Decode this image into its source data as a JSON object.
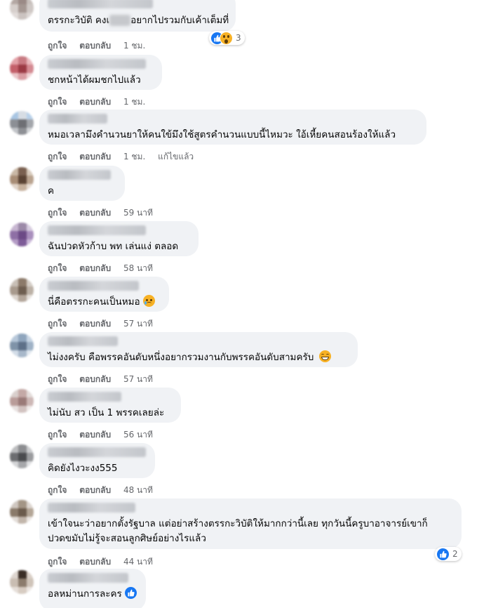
{
  "colors": {
    "bubble": "#f0f2f5",
    "action_text": "#65676b",
    "like_blue": "#1877f2",
    "emoji_yellow": "#f7b125"
  },
  "action_labels": {
    "like": "ถูกใจ",
    "reply": "ตอบกลับ"
  },
  "comments": [
    {
      "text_before": "ตรรกะวิบัติ คงเ",
      "text_after": "อยากไปรวมกับเค้าเต็มที่",
      "time": "1 ชม.",
      "reactions": {
        "icons": [
          "like-icon",
          "wow-icon"
        ],
        "count": "3"
      }
    },
    {
      "text": "ชกหน้าได้ผมชกไปแล้ว",
      "time": "1 ชม."
    },
    {
      "text": "หมอเวลามึงคำนวนยาให้คนใข้มึงใช้สูตรคำนวนแบบนี้ไหมวะ ใอ้เหี้ยคนสอนร้องให้แล้ว",
      "time": "1 ชม.",
      "edited": "แก้ไขแล้ว"
    },
    {
      "text": "ค",
      "time": "59 นาที"
    },
    {
      "text": "ฉันปวดหัวก้าบ พท เล่นแง่ ตลอด",
      "time": "58 นาที"
    },
    {
      "text": "นี่คือตรรกะคนเป็นหมอ",
      "emoji": "sad-tear-emoji",
      "time": "57 นาที"
    },
    {
      "text": "ไม่งงครับ คือพรรคอันดับหนึ่งอยากรวมงานกับพรรคอันดับสามครับ",
      "emoji": "grin-sweat-emoji",
      "time": "57 นาที"
    },
    {
      "text": "ไม่นับ สว เป็น 1 พรรคเลยล่ะ",
      "time": "56 นาที"
    },
    {
      "text": "คิดยังไงวะงง555",
      "time": "48 นาที"
    },
    {
      "line1": "เข้าใจนะว่าอยากตั้งรัฐบาล แต่อย่าสร้างตรรกะวิบัติให้มากกว่านี้เลย ทุกวันนี้ครูบาอาจารย์เขาก็",
      "line2": "ปวดขมับไม่รู้จะสอนลูกศิษย์อย่างไรแล้ว",
      "time": "44 นาที",
      "reactions": {
        "icons": [
          "like-icon"
        ],
        "count": "2"
      }
    },
    {
      "text": "อลหม่านการละคร",
      "emoji": "like-emoji"
    }
  ]
}
